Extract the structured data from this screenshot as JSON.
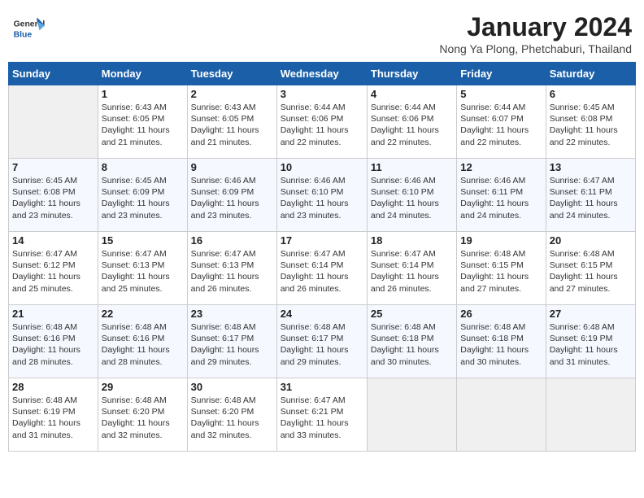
{
  "header": {
    "logo_general": "General",
    "logo_blue": "Blue",
    "month_title": "January 2024",
    "location": "Nong Ya Plong, Phetchaburi, Thailand"
  },
  "weekdays": [
    "Sunday",
    "Monday",
    "Tuesday",
    "Wednesday",
    "Thursday",
    "Friday",
    "Saturday"
  ],
  "weeks": [
    [
      {
        "day": "",
        "sunrise": "",
        "sunset": "",
        "daylight": ""
      },
      {
        "day": "1",
        "sunrise": "Sunrise: 6:43 AM",
        "sunset": "Sunset: 6:05 PM",
        "daylight": "Daylight: 11 hours and 21 minutes."
      },
      {
        "day": "2",
        "sunrise": "Sunrise: 6:43 AM",
        "sunset": "Sunset: 6:05 PM",
        "daylight": "Daylight: 11 hours and 21 minutes."
      },
      {
        "day": "3",
        "sunrise": "Sunrise: 6:44 AM",
        "sunset": "Sunset: 6:06 PM",
        "daylight": "Daylight: 11 hours and 22 minutes."
      },
      {
        "day": "4",
        "sunrise": "Sunrise: 6:44 AM",
        "sunset": "Sunset: 6:06 PM",
        "daylight": "Daylight: 11 hours and 22 minutes."
      },
      {
        "day": "5",
        "sunrise": "Sunrise: 6:44 AM",
        "sunset": "Sunset: 6:07 PM",
        "daylight": "Daylight: 11 hours and 22 minutes."
      },
      {
        "day": "6",
        "sunrise": "Sunrise: 6:45 AM",
        "sunset": "Sunset: 6:08 PM",
        "daylight": "Daylight: 11 hours and 22 minutes."
      }
    ],
    [
      {
        "day": "7",
        "sunrise": "Sunrise: 6:45 AM",
        "sunset": "Sunset: 6:08 PM",
        "daylight": "Daylight: 11 hours and 23 minutes."
      },
      {
        "day": "8",
        "sunrise": "Sunrise: 6:45 AM",
        "sunset": "Sunset: 6:09 PM",
        "daylight": "Daylight: 11 hours and 23 minutes."
      },
      {
        "day": "9",
        "sunrise": "Sunrise: 6:46 AM",
        "sunset": "Sunset: 6:09 PM",
        "daylight": "Daylight: 11 hours and 23 minutes."
      },
      {
        "day": "10",
        "sunrise": "Sunrise: 6:46 AM",
        "sunset": "Sunset: 6:10 PM",
        "daylight": "Daylight: 11 hours and 23 minutes."
      },
      {
        "day": "11",
        "sunrise": "Sunrise: 6:46 AM",
        "sunset": "Sunset: 6:10 PM",
        "daylight": "Daylight: 11 hours and 24 minutes."
      },
      {
        "day": "12",
        "sunrise": "Sunrise: 6:46 AM",
        "sunset": "Sunset: 6:11 PM",
        "daylight": "Daylight: 11 hours and 24 minutes."
      },
      {
        "day": "13",
        "sunrise": "Sunrise: 6:47 AM",
        "sunset": "Sunset: 6:11 PM",
        "daylight": "Daylight: 11 hours and 24 minutes."
      }
    ],
    [
      {
        "day": "14",
        "sunrise": "Sunrise: 6:47 AM",
        "sunset": "Sunset: 6:12 PM",
        "daylight": "Daylight: 11 hours and 25 minutes."
      },
      {
        "day": "15",
        "sunrise": "Sunrise: 6:47 AM",
        "sunset": "Sunset: 6:13 PM",
        "daylight": "Daylight: 11 hours and 25 minutes."
      },
      {
        "day": "16",
        "sunrise": "Sunrise: 6:47 AM",
        "sunset": "Sunset: 6:13 PM",
        "daylight": "Daylight: 11 hours and 26 minutes."
      },
      {
        "day": "17",
        "sunrise": "Sunrise: 6:47 AM",
        "sunset": "Sunset: 6:14 PM",
        "daylight": "Daylight: 11 hours and 26 minutes."
      },
      {
        "day": "18",
        "sunrise": "Sunrise: 6:47 AM",
        "sunset": "Sunset: 6:14 PM",
        "daylight": "Daylight: 11 hours and 26 minutes."
      },
      {
        "day": "19",
        "sunrise": "Sunrise: 6:48 AM",
        "sunset": "Sunset: 6:15 PM",
        "daylight": "Daylight: 11 hours and 27 minutes."
      },
      {
        "day": "20",
        "sunrise": "Sunrise: 6:48 AM",
        "sunset": "Sunset: 6:15 PM",
        "daylight": "Daylight: 11 hours and 27 minutes."
      }
    ],
    [
      {
        "day": "21",
        "sunrise": "Sunrise: 6:48 AM",
        "sunset": "Sunset: 6:16 PM",
        "daylight": "Daylight: 11 hours and 28 minutes."
      },
      {
        "day": "22",
        "sunrise": "Sunrise: 6:48 AM",
        "sunset": "Sunset: 6:16 PM",
        "daylight": "Daylight: 11 hours and 28 minutes."
      },
      {
        "day": "23",
        "sunrise": "Sunrise: 6:48 AM",
        "sunset": "Sunset: 6:17 PM",
        "daylight": "Daylight: 11 hours and 29 minutes."
      },
      {
        "day": "24",
        "sunrise": "Sunrise: 6:48 AM",
        "sunset": "Sunset: 6:17 PM",
        "daylight": "Daylight: 11 hours and 29 minutes."
      },
      {
        "day": "25",
        "sunrise": "Sunrise: 6:48 AM",
        "sunset": "Sunset: 6:18 PM",
        "daylight": "Daylight: 11 hours and 30 minutes."
      },
      {
        "day": "26",
        "sunrise": "Sunrise: 6:48 AM",
        "sunset": "Sunset: 6:18 PM",
        "daylight": "Daylight: 11 hours and 30 minutes."
      },
      {
        "day": "27",
        "sunrise": "Sunrise: 6:48 AM",
        "sunset": "Sunset: 6:19 PM",
        "daylight": "Daylight: 11 hours and 31 minutes."
      }
    ],
    [
      {
        "day": "28",
        "sunrise": "Sunrise: 6:48 AM",
        "sunset": "Sunset: 6:19 PM",
        "daylight": "Daylight: 11 hours and 31 minutes."
      },
      {
        "day": "29",
        "sunrise": "Sunrise: 6:48 AM",
        "sunset": "Sunset: 6:20 PM",
        "daylight": "Daylight: 11 hours and 32 minutes."
      },
      {
        "day": "30",
        "sunrise": "Sunrise: 6:48 AM",
        "sunset": "Sunset: 6:20 PM",
        "daylight": "Daylight: 11 hours and 32 minutes."
      },
      {
        "day": "31",
        "sunrise": "Sunrise: 6:47 AM",
        "sunset": "Sunset: 6:21 PM",
        "daylight": "Daylight: 11 hours and 33 minutes."
      },
      {
        "day": "",
        "sunrise": "",
        "sunset": "",
        "daylight": ""
      },
      {
        "day": "",
        "sunrise": "",
        "sunset": "",
        "daylight": ""
      },
      {
        "day": "",
        "sunrise": "",
        "sunset": "",
        "daylight": ""
      }
    ]
  ]
}
